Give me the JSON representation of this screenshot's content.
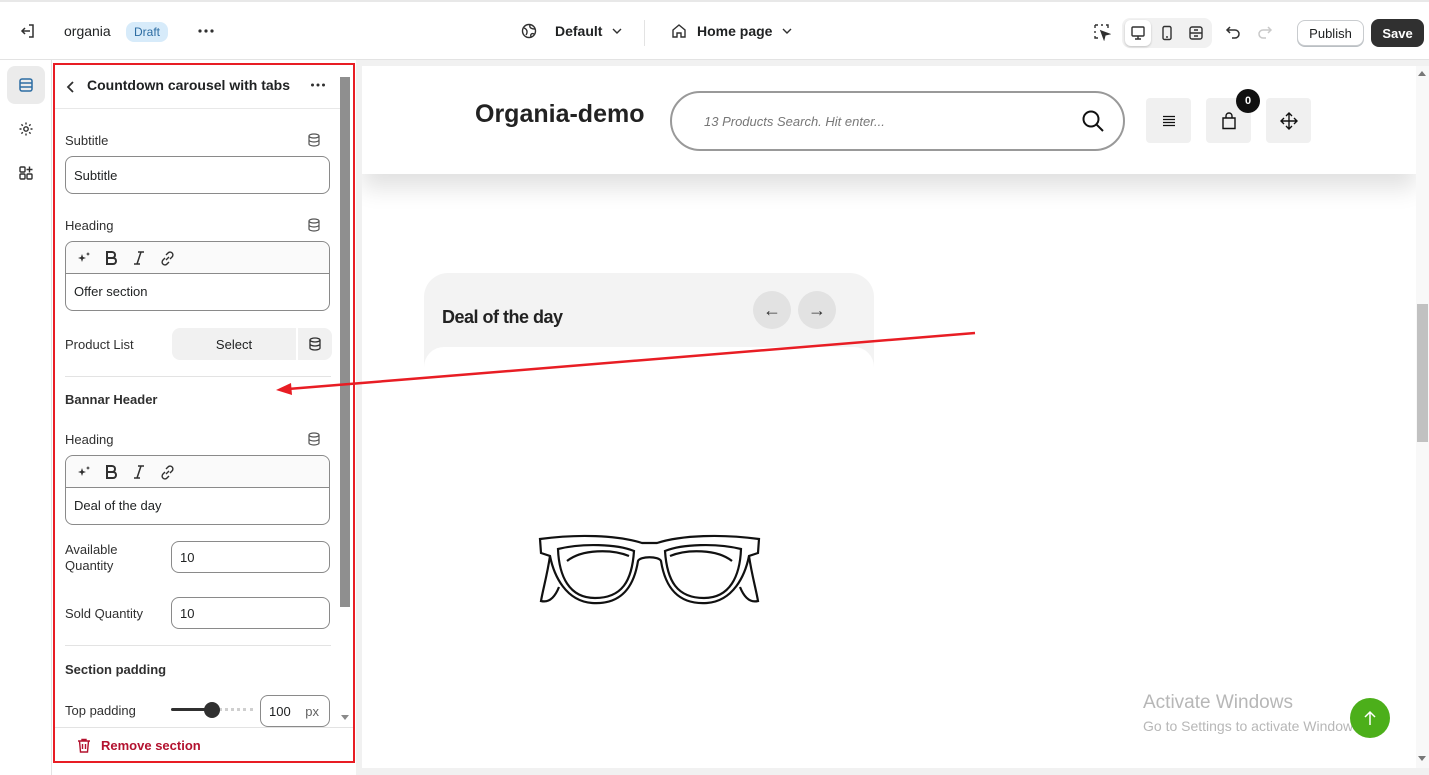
{
  "topbar": {
    "theme_name": "organia",
    "status_badge": "Draft",
    "template_selector": "Default",
    "page_selector": "Home page",
    "publish_label": "Publish",
    "save_label": "Save"
  },
  "panel": {
    "title": "Countdown carousel with tabs",
    "subtitle_label": "Subtitle",
    "subtitle_value": "Subtitle",
    "heading_label": "Heading",
    "heading_value": "Offer section",
    "product_list_label": "Product List",
    "product_list_button": "Select",
    "banner_section_title": "Bannar Header",
    "banner_heading_label": "Heading",
    "banner_heading_value": "Deal of the day",
    "available_quantity_label": "Available Quantity",
    "available_quantity_value": "10",
    "sold_quantity_label": "Sold Quantity",
    "sold_quantity_value": "10",
    "section_padding_title": "Section padding",
    "top_padding_label": "Top padding",
    "top_padding_value": "100",
    "top_padding_unit": "px",
    "top_padding_slider_fraction": 0.5,
    "remove_section_label": "Remove section"
  },
  "preview": {
    "store_title": "Organia-demo",
    "search_placeholder": "13 Products Search. Hit enter...",
    "cart_count": "0",
    "deal_title": "Deal of the day",
    "watermark_title": "Activate Windows",
    "watermark_subtitle": "Go to Settings to activate Windows."
  },
  "colors": {
    "annotation_red": "#e81d24",
    "save_bg": "#303030",
    "draft_badge_bg": "#d7ebfa",
    "back_to_top_green": "#4caf1a"
  }
}
